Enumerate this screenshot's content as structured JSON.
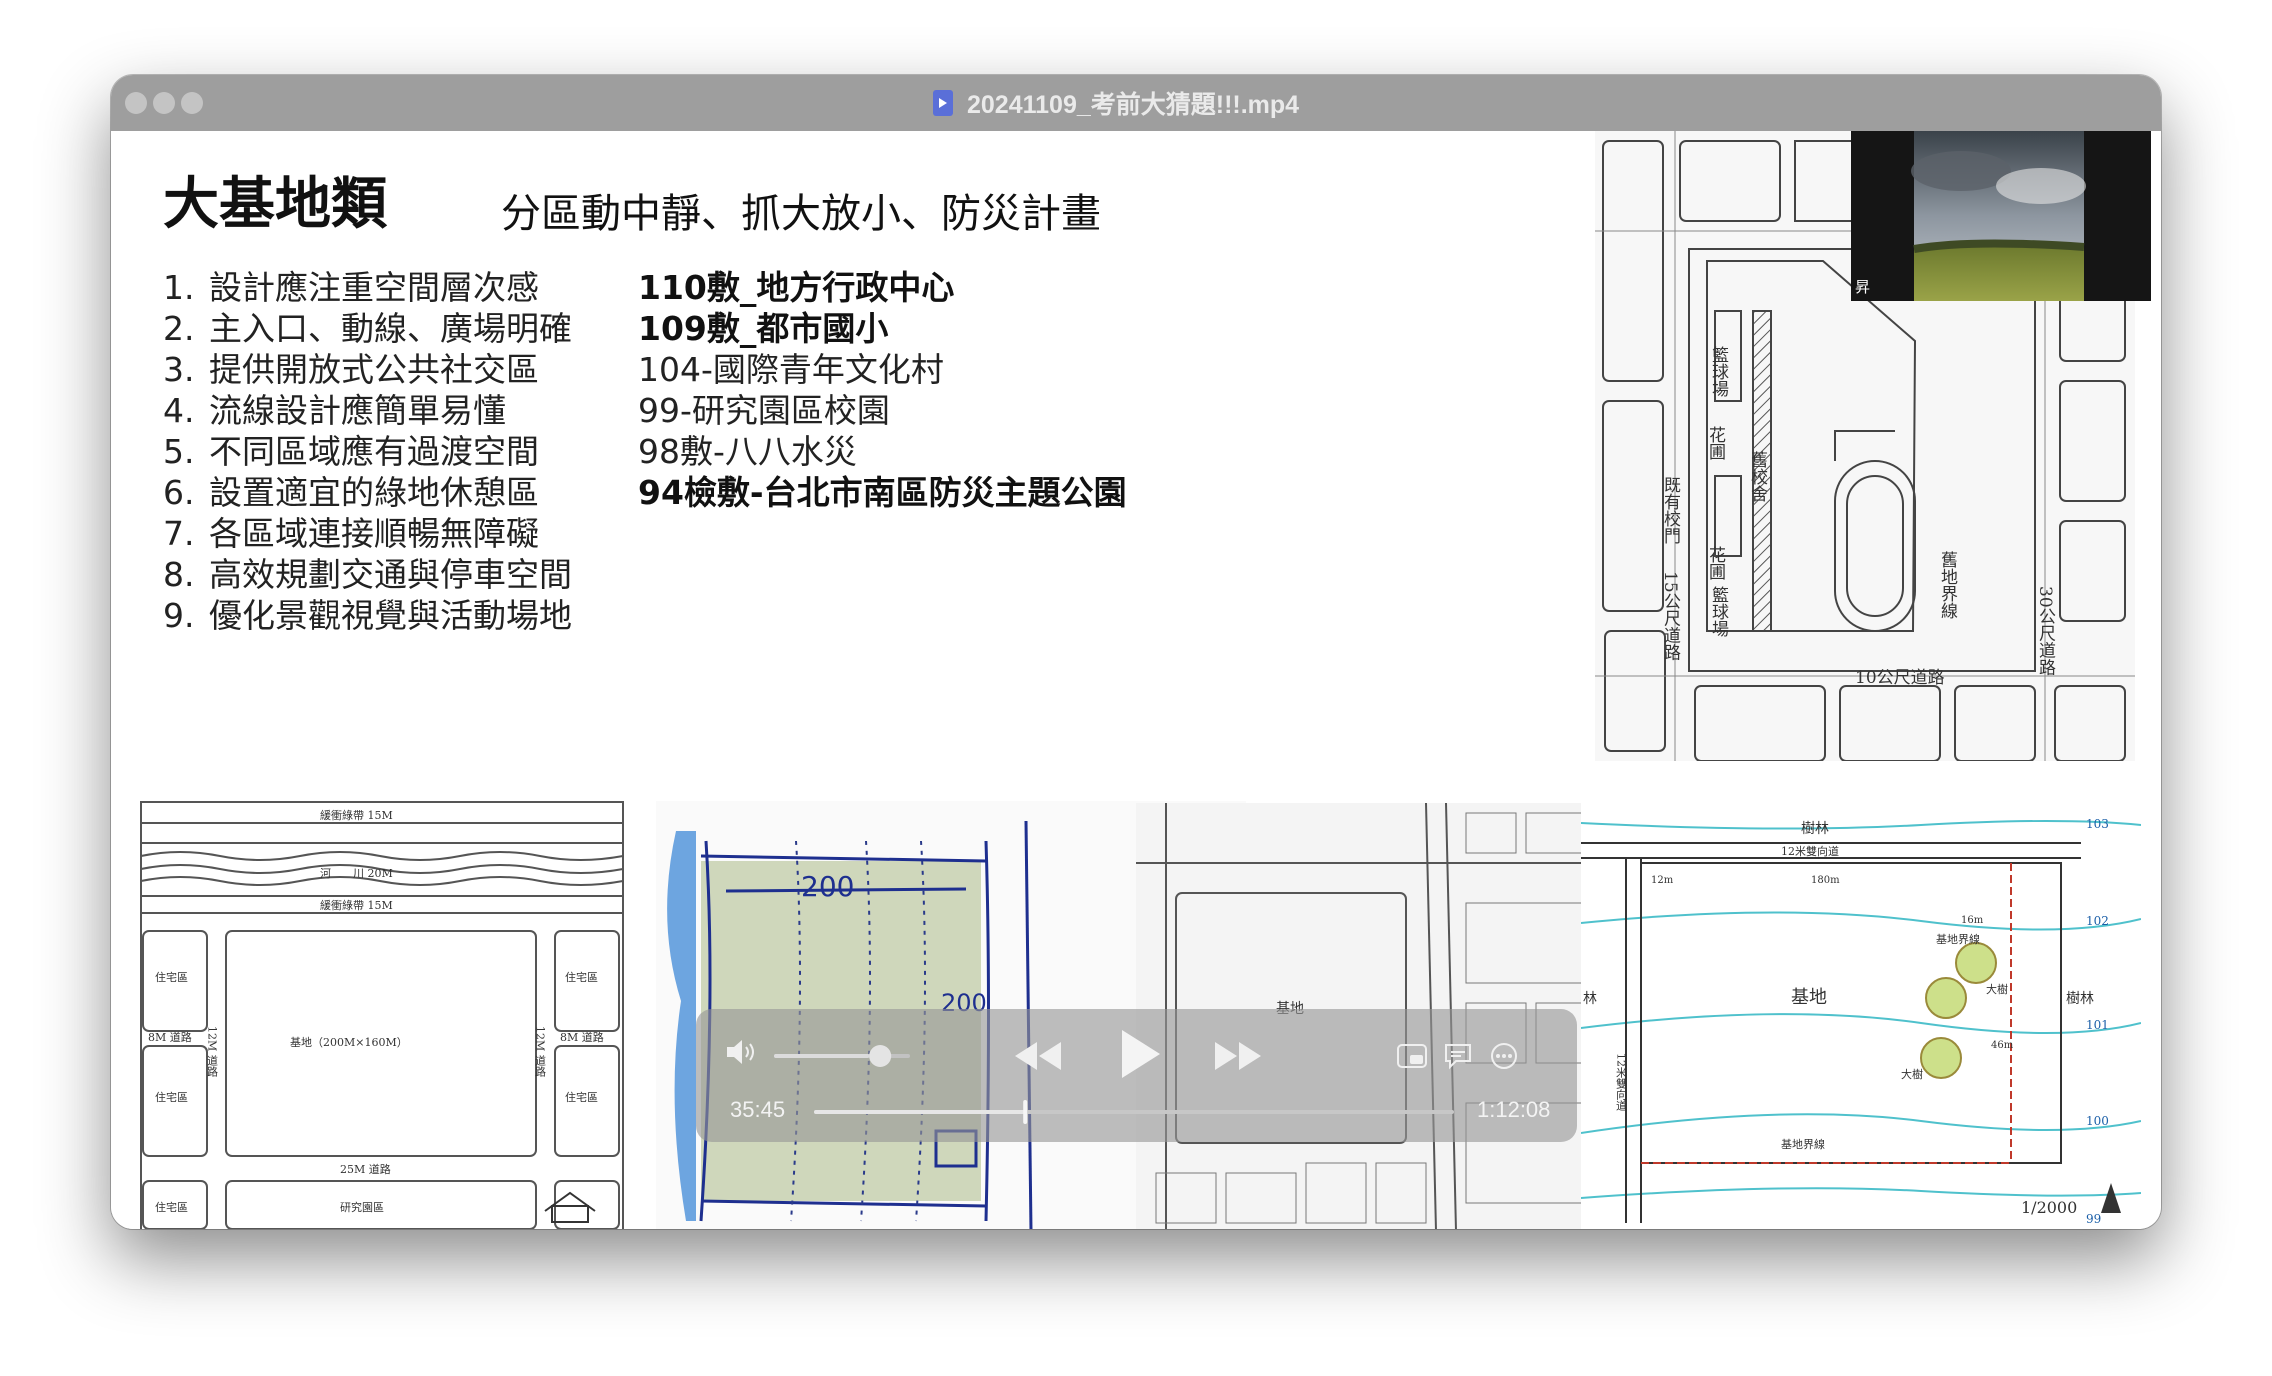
{
  "window": {
    "title": "20241109_考前大猜題!!!.mp4"
  },
  "slide": {
    "heading": "大基地類",
    "subheading": "分區動中靜、抓大放小、防災計畫",
    "points": [
      {
        "num": "1.",
        "text": "設計應注重空間層次感"
      },
      {
        "num": "2.",
        "text": "主入口、動線、廣場明確"
      },
      {
        "num": "3.",
        "text": "提供開放式公共社交區"
      },
      {
        "num": "4.",
        "text": "流線設計應簡單易懂"
      },
      {
        "num": "5.",
        "text": "不同區域應有過渡空間"
      },
      {
        "num": "6.",
        "text": "設置適宜的綠地休憩區"
      },
      {
        "num": "7.",
        "text": "各區域連接順暢無障礙"
      },
      {
        "num": "8.",
        "text": "高效規劃交通與停車空間"
      },
      {
        "num": "9.",
        "text": "優化景觀視覺與活動場地"
      }
    ],
    "exams": [
      {
        "text": "110敷_地方行政中心",
        "bold": true
      },
      {
        "text": "109敷_都市國小",
        "bold": true
      },
      {
        "text": "104-國際青年文化村",
        "bold": false
      },
      {
        "text": "99-研究園區校園",
        "bold": false
      },
      {
        "text": "98敷-八八水災",
        "bold": false
      },
      {
        "text": "94檢敷-台北市南區防災主題公園",
        "bold": true
      }
    ],
    "map_school": {
      "court_top": "籃球場",
      "garden1": "花圃",
      "old_building": "舊校舍",
      "garden2": "花圃",
      "court_bottom": "籃球場",
      "existing_school": "既有校門",
      "road_15": "15公尺道路",
      "boundary": "舊地界線",
      "road_30": "30公尺道路",
      "road_10": "10公尺道路"
    },
    "map_plan": {
      "buffer_top": "緩衝綠帶 15M",
      "river": "河　　川 20M",
      "buffer_bottom": "緩衝綠帶 15M",
      "residential": "住宅區",
      "site": "基地（200M×160M）",
      "road_8m": "8M 道路",
      "road_12m": "12M 道路",
      "road_25m": "25M 道路",
      "research": "研究園區"
    },
    "map_sketch": {
      "dim_top": "200",
      "dim_side": "200"
    },
    "map_urban": {
      "site": "基地"
    },
    "map_contour": {
      "forest_top": "樹林",
      "road_top": "12米雙向道",
      "road_side": "12米雙向道",
      "forest_left": "林",
      "forest_right": "樹林",
      "site": "基地",
      "big_tree1": "大樹",
      "big_tree2": "大樹",
      "site_line1": "基地界線",
      "site_line2": "基地界線",
      "dim_180": "180m",
      "dim_12": "12m",
      "dim_16": "16m",
      "dim_46": "46m",
      "contours": [
        "103",
        "102",
        "101",
        "100",
        "99"
      ],
      "scale": "1/2000"
    }
  },
  "webcam": {
    "name": "昇"
  },
  "player": {
    "elapsed": "35:45",
    "remaining": "1:12:08",
    "progress": 0.33,
    "volume": 0.7
  }
}
